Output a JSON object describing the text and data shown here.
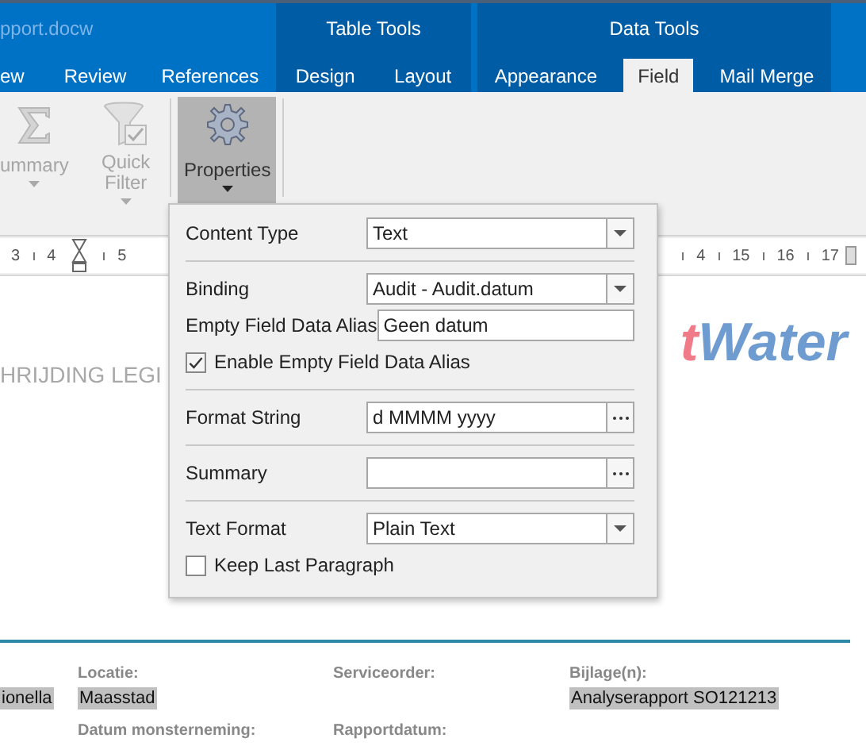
{
  "window": {
    "title": "pport.docw"
  },
  "tabs": [
    {
      "label": "ew",
      "selected": false
    },
    {
      "label": "Review",
      "selected": false
    },
    {
      "label": "References",
      "selected": false
    }
  ],
  "tool_groups": [
    {
      "title": "Table Tools",
      "tabs": [
        {
          "label": "Design",
          "selected": false
        },
        {
          "label": "Layout",
          "selected": false
        }
      ]
    },
    {
      "title": "Data Tools",
      "tabs": [
        {
          "label": "Appearance",
          "selected": false
        },
        {
          "label": "Field",
          "selected": true
        },
        {
          "label": "Mail Merge",
          "selected": false
        }
      ]
    }
  ],
  "ribbon": {
    "buttons": [
      {
        "kind": "sigma",
        "label": "ummary",
        "disabled": true,
        "pressed": false
      },
      {
        "kind": "filter",
        "label": "Quick Filter",
        "disabled": true,
        "pressed": false
      },
      {
        "kind": "gear",
        "label": "Properties",
        "disabled": false,
        "pressed": true
      }
    ]
  },
  "ruler": {
    "left_marks": [
      "3",
      "4",
      "5"
    ],
    "right_marks": [
      "4",
      "15",
      "16",
      "17"
    ]
  },
  "properties_panel": {
    "rows": [
      {
        "kind": "dropdown",
        "label": "Content Type",
        "value": "Text"
      },
      {
        "kind": "separator"
      },
      {
        "kind": "dropdown",
        "label": "Binding",
        "value": "Audit - Audit.datum"
      },
      {
        "kind": "text",
        "label": "Empty Field Data Alias",
        "value": "Geen datum"
      },
      {
        "kind": "checkbox",
        "label": "Enable Empty Field Data Alias",
        "checked": true
      },
      {
        "kind": "separator"
      },
      {
        "kind": "ellipsis",
        "label": "Format String",
        "value": "d MMMM yyyy"
      },
      {
        "kind": "separator"
      },
      {
        "kind": "ellipsis",
        "label": "Summary"
      },
      {
        "kind": "separator"
      },
      {
        "kind": "dropdown",
        "label": "Text Format",
        "value": "Plain Text"
      },
      {
        "kind": "checkbox",
        "label": "Keep Last Paragraph",
        "checked": false
      }
    ]
  },
  "document": {
    "heading": "HRIJDING LEGI",
    "logo": {
      "accent": "t",
      "text": "Water"
    },
    "fields": [
      {
        "value": "ionella"
      },
      {
        "label": "Locatie:",
        "value": "Maasstad"
      },
      {
        "label": "Serviceorder:"
      },
      {
        "label": "Bijlage(n):",
        "value": "Analyserapport SO121213"
      }
    ],
    "next_labels": [
      "Datum monsterneming:",
      "Rapportdatum:"
    ]
  }
}
